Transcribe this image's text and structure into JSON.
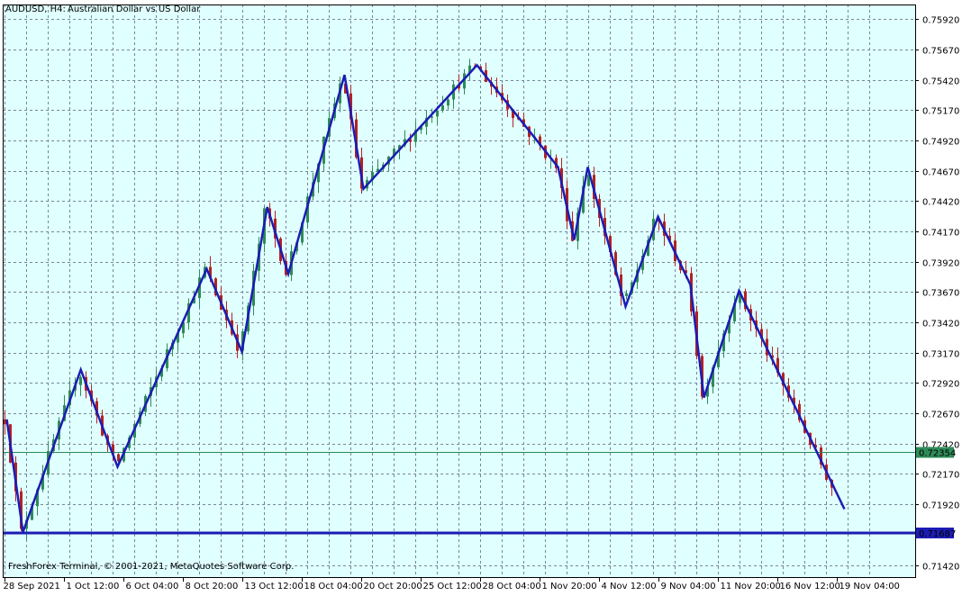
{
  "header": {
    "symbol": "AUDUSD, H4:",
    "description": "Australian Dollar vs US Dollar"
  },
  "copyright": "FreshForex Terminal, © 2001-2021, MetaQuotes Software Corp.",
  "colors": {
    "background": "#e0ffff",
    "grid": "#778899",
    "bull_candle": "#2e8b57",
    "bear_candle": "#b22222",
    "zigzag": "#1c1cb4",
    "support_line": "#1c1cb4",
    "bid_line": "#2e8b57",
    "axis_text": "#000000"
  },
  "chart_data": {
    "type": "candlestick",
    "timeframe": "H4",
    "x_ticks": [
      "28 Sep 2021",
      "1 Oct 12:00",
      "6 Oct 04:00",
      "8 Oct 20:00",
      "13 Oct 12:00",
      "18 Oct 04:00",
      "20 Oct 20:00",
      "25 Oct 12:00",
      "28 Oct 04:00",
      "1 Nov 20:00",
      "4 Nov 12:00",
      "9 Nov 04:00",
      "11 Nov 20:00",
      "16 Nov 12:00",
      "19 Nov 04:00"
    ],
    "y_ticks": [
      "0.75920",
      "0.75670",
      "0.75420",
      "0.75170",
      "0.74920",
      "0.74670",
      "0.74420",
      "0.74170",
      "0.73920",
      "0.73670",
      "0.73420",
      "0.73170",
      "0.72920",
      "0.72670",
      "0.72420",
      "0.72170",
      "0.71920",
      "0.71420"
    ],
    "ylim": [
      0.7132,
      0.7604
    ],
    "current_price": "0.72354",
    "support_level": "0.71687",
    "zigzag_points": [
      [
        0.5,
        0.7262
      ],
      [
        3.5,
        0.7169
      ],
      [
        14.2,
        0.7303
      ],
      [
        21.0,
        0.7223
      ],
      [
        37.5,
        0.7386
      ],
      [
        44.0,
        0.7318
      ],
      [
        48.7,
        0.7437
      ],
      [
        52.6,
        0.7382
      ],
      [
        63.0,
        0.7546
      ],
      [
        66.5,
        0.7452
      ],
      [
        87.5,
        0.7554
      ],
      [
        102.5,
        0.747
      ],
      [
        105.5,
        0.741
      ],
      [
        108.0,
        0.747
      ],
      [
        115.0,
        0.7355
      ],
      [
        121.0,
        0.7429
      ],
      [
        127.0,
        0.7373
      ],
      [
        129.5,
        0.728
      ],
      [
        136.0,
        0.7368
      ],
      [
        155.5,
        0.7188
      ]
    ],
    "candles": []
  }
}
